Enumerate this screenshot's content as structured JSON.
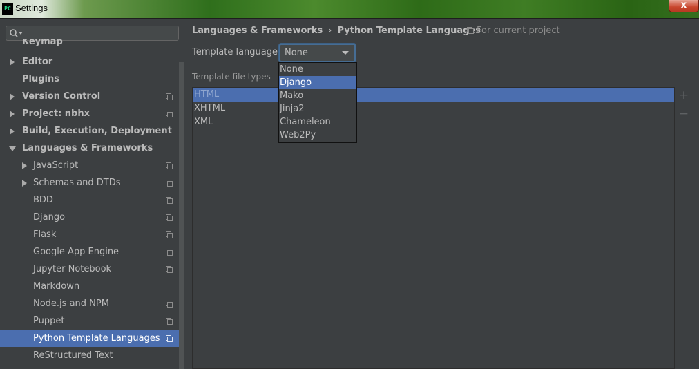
{
  "window": {
    "app_icon_text": "PC",
    "title": "Settings",
    "close_label": "x"
  },
  "search": {
    "value": "",
    "placeholder": ""
  },
  "sidebar": {
    "items": [
      {
        "label": "Keymap",
        "bold": true,
        "arrow": "none",
        "indent": 0,
        "scope_icon": false,
        "partial": true
      },
      {
        "label": "Editor",
        "bold": true,
        "arrow": "right",
        "indent": 0,
        "scope_icon": false
      },
      {
        "label": "Plugins",
        "bold": true,
        "arrow": "none",
        "indent": 0,
        "scope_icon": false
      },
      {
        "label": "Version Control",
        "bold": true,
        "arrow": "right",
        "indent": 0,
        "scope_icon": true
      },
      {
        "label": "Project: nbhx",
        "bold": true,
        "arrow": "right",
        "indent": 0,
        "scope_icon": true
      },
      {
        "label": "Build, Execution, Deployment",
        "bold": true,
        "arrow": "right",
        "indent": 0,
        "scope_icon": false
      },
      {
        "label": "Languages & Frameworks",
        "bold": true,
        "arrow": "down",
        "indent": 0,
        "scope_icon": false
      },
      {
        "label": "JavaScript",
        "bold": false,
        "arrow": "right",
        "indent": 1,
        "scope_icon": true
      },
      {
        "label": "Schemas and DTDs",
        "bold": false,
        "arrow": "right",
        "indent": 1,
        "scope_icon": true
      },
      {
        "label": "BDD",
        "bold": false,
        "arrow": "none",
        "indent": 1,
        "scope_icon": true
      },
      {
        "label": "Django",
        "bold": false,
        "arrow": "none",
        "indent": 1,
        "scope_icon": true
      },
      {
        "label": "Flask",
        "bold": false,
        "arrow": "none",
        "indent": 1,
        "scope_icon": true
      },
      {
        "label": "Google App Engine",
        "bold": false,
        "arrow": "none",
        "indent": 1,
        "scope_icon": true
      },
      {
        "label": "Jupyter Notebook",
        "bold": false,
        "arrow": "none",
        "indent": 1,
        "scope_icon": true
      },
      {
        "label": "Markdown",
        "bold": false,
        "arrow": "none",
        "indent": 1,
        "scope_icon": false
      },
      {
        "label": "Node.js and NPM",
        "bold": false,
        "arrow": "none",
        "indent": 1,
        "scope_icon": true
      },
      {
        "label": "Puppet",
        "bold": false,
        "arrow": "none",
        "indent": 1,
        "scope_icon": true
      },
      {
        "label": "Python Template Languages",
        "bold": false,
        "arrow": "none",
        "indent": 1,
        "scope_icon": true,
        "selected": true
      },
      {
        "label": "ReStructured Text",
        "bold": false,
        "arrow": "none",
        "indent": 1,
        "scope_icon": false
      }
    ]
  },
  "main": {
    "breadcrumb": {
      "parent": "Languages & Frameworks",
      "separator": "›",
      "current": "Python Template Languages"
    },
    "scope_hint": "For current project",
    "template_language_label": "Template language:",
    "template_language_value": "None",
    "file_types_title": "Template file types",
    "file_types": [
      {
        "label": "HTML",
        "selected": true
      },
      {
        "label": "XHTML",
        "selected": false
      },
      {
        "label": "XML",
        "selected": false
      }
    ],
    "add_label": "+",
    "remove_label": "−"
  },
  "dropdown": {
    "options": [
      {
        "label": "None",
        "selected": false
      },
      {
        "label": "Django",
        "selected": true
      },
      {
        "label": "Mako",
        "selected": false
      },
      {
        "label": "Jinja2",
        "selected": false
      },
      {
        "label": "Chameleon",
        "selected": false
      },
      {
        "label": "Web2Py",
        "selected": false
      }
    ]
  },
  "colors": {
    "background": "#3c3f41",
    "selection": "#4b6eaf",
    "text": "#bbbbbb",
    "focus_border": "#466d94"
  }
}
